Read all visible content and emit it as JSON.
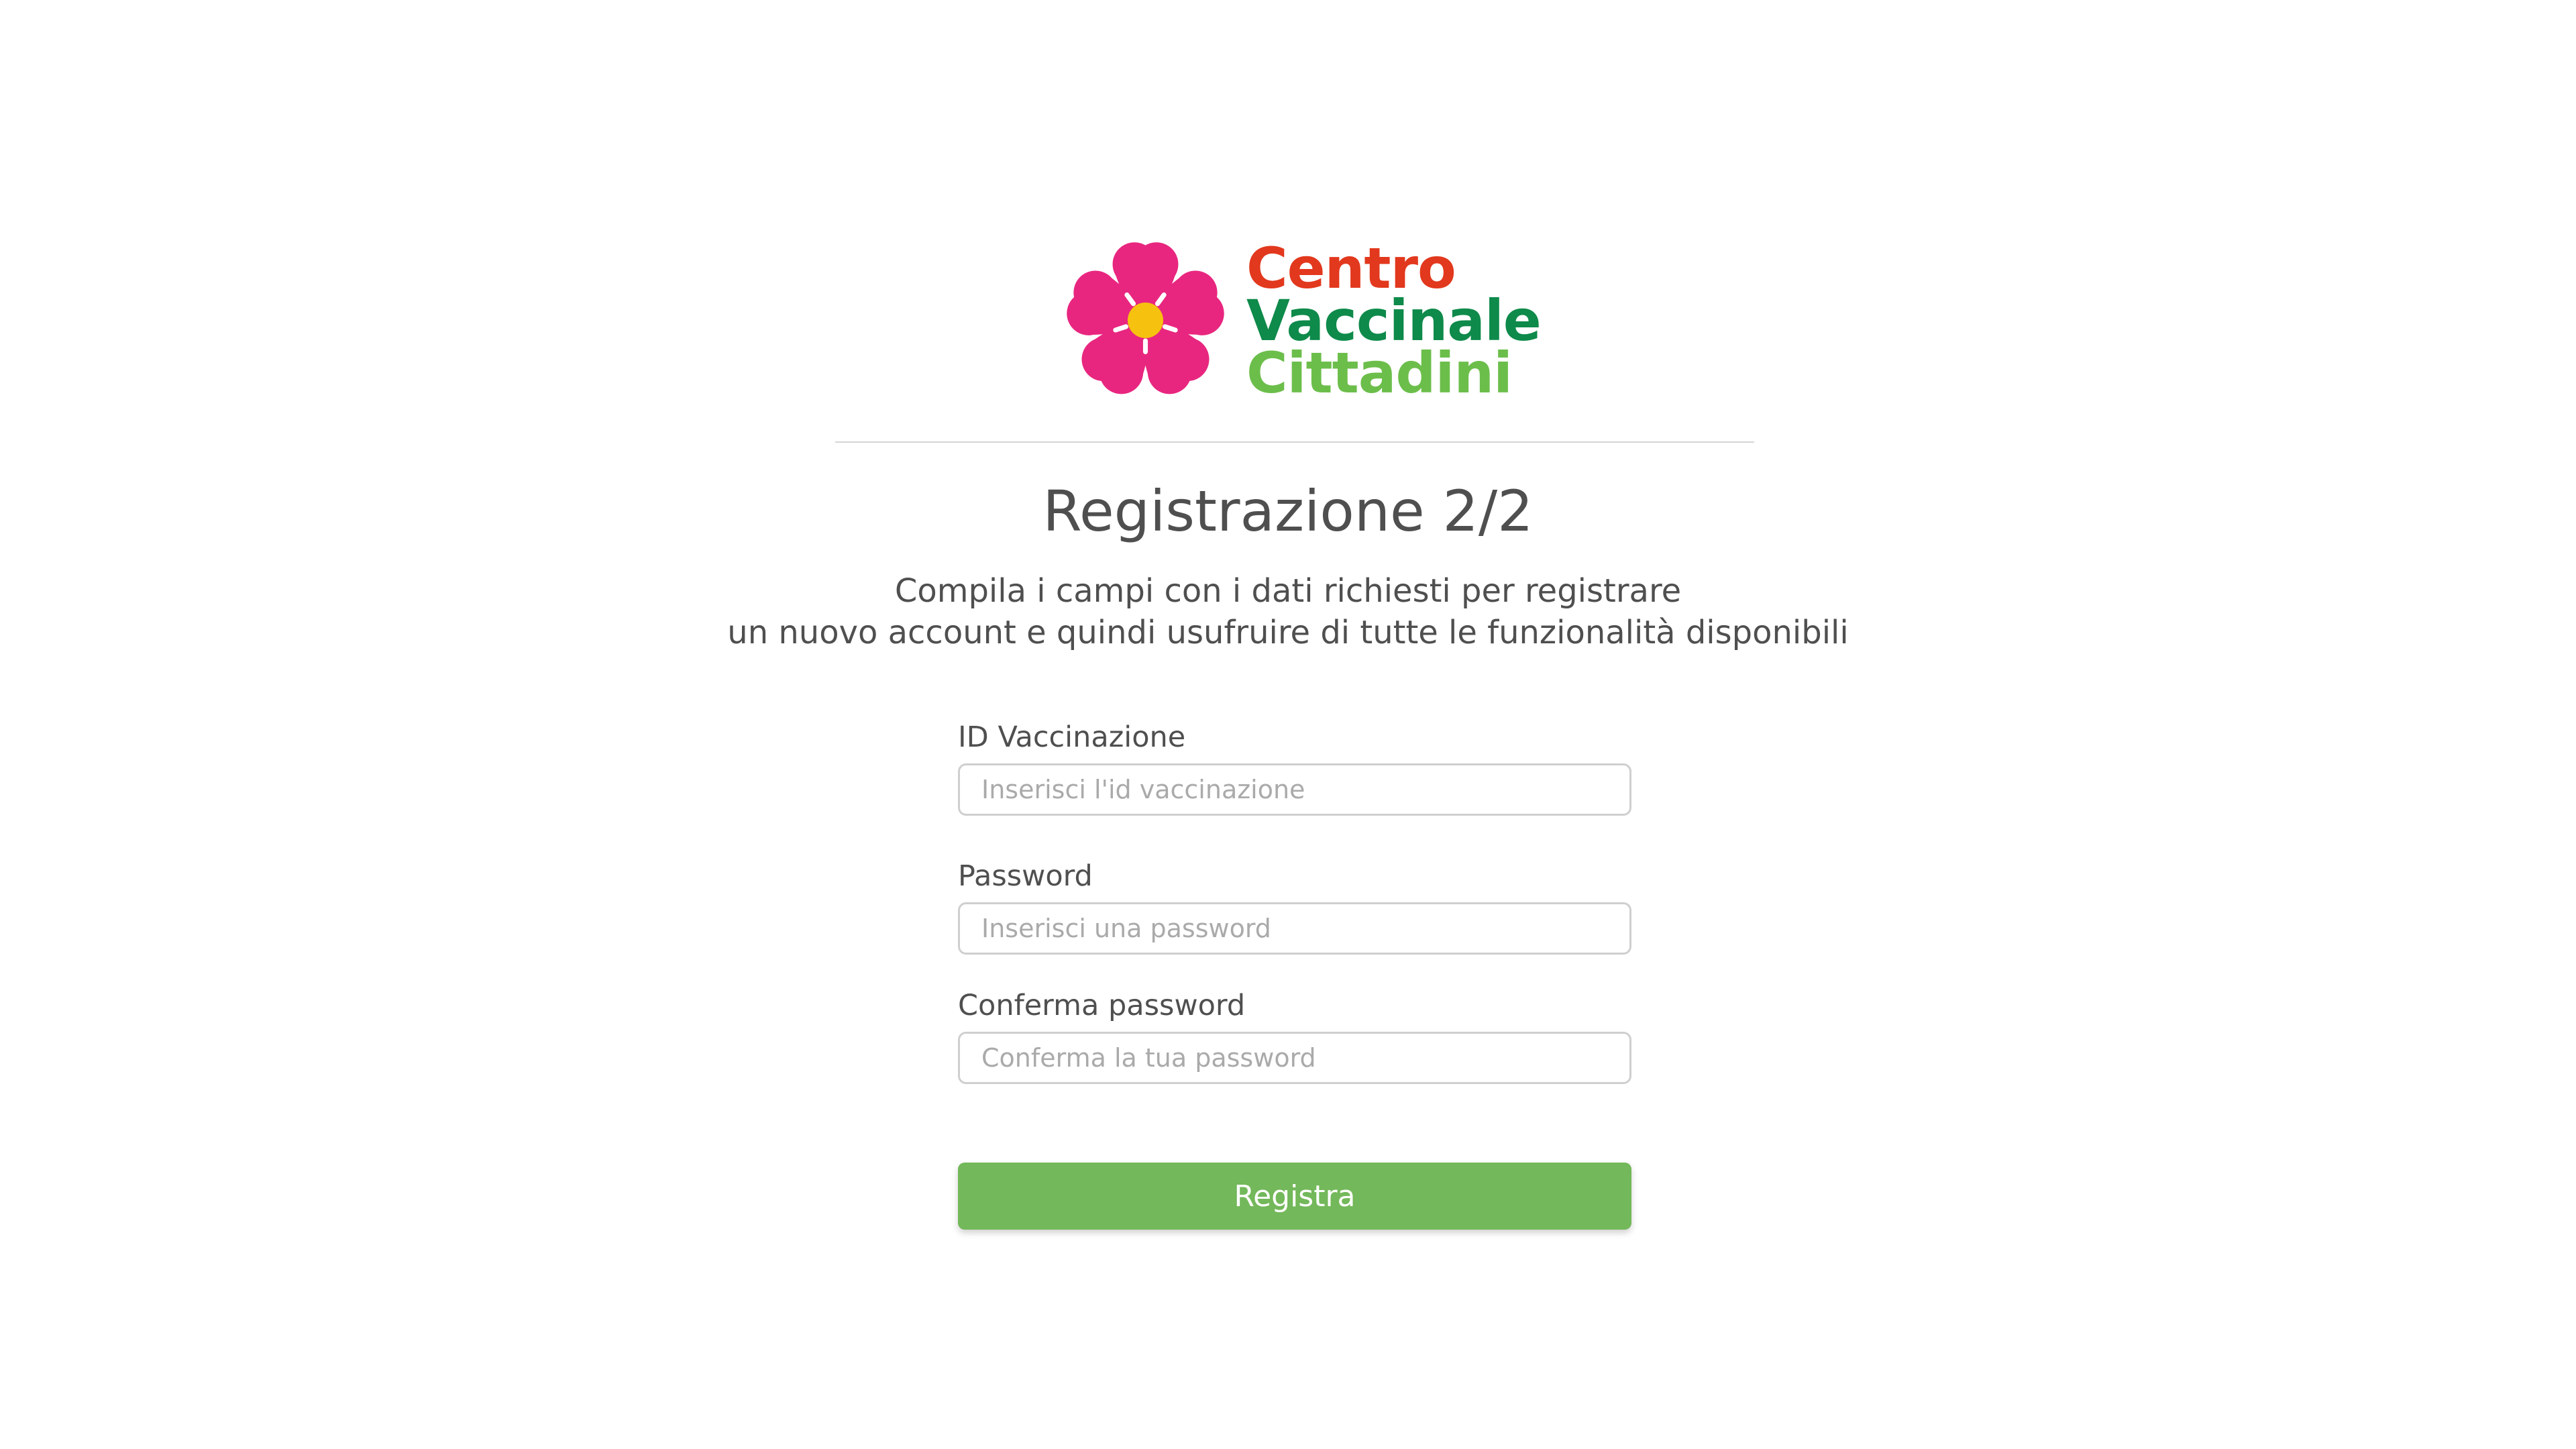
{
  "logo": {
    "line1": "Centro",
    "line2": "Vaccinale",
    "line3": "Cittadini",
    "colors": {
      "line1": "#e2381d",
      "line2": "#0e8a4a",
      "line3": "#6cbe4b",
      "flower_petals": "#e8267f",
      "flower_center": "#f6c20f"
    },
    "icon": "flower-icon"
  },
  "page": {
    "title": "Registrazione 2/2",
    "subtitle_line1": "Compila i campi con i dati richiesti per registrare",
    "subtitle_line2": "un nuovo account e quindi usufruire di tutte le funzionalità disponibili"
  },
  "form": {
    "vaccination_id": {
      "label": "ID Vaccinazione",
      "placeholder": "Inserisci l'id vaccinazione",
      "value": ""
    },
    "password": {
      "label": "Password",
      "placeholder": "Inserisci una password",
      "value": ""
    },
    "confirm_password": {
      "label": "Conferma password",
      "placeholder": "Conferma la tua password",
      "value": ""
    },
    "submit_label": "Registra",
    "submit_color": "#73b85a"
  }
}
